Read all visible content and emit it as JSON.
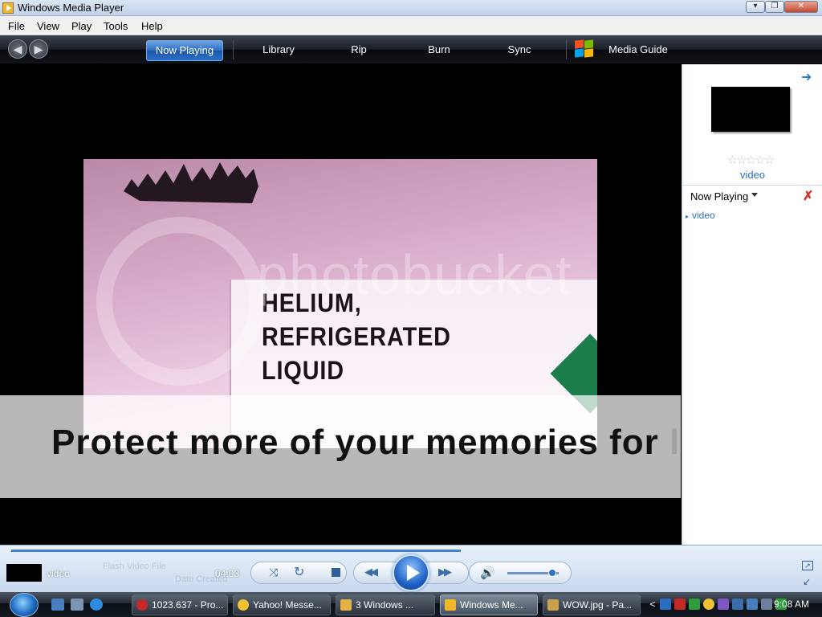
{
  "window": {
    "title": "Windows Media Player",
    "min": "▾",
    "max": "❐",
    "close": "✕"
  },
  "menu": [
    "File",
    "View",
    "Play",
    "Tools",
    "Help"
  ],
  "nav": {
    "back": "◀",
    "forward": "▶",
    "tabs": [
      "Now Playing",
      "Library",
      "Rip",
      "Burn",
      "Sync",
      "Media Guide"
    ]
  },
  "video": {
    "sign_text": "HELIUM,\nREFRIGERATED\nLIQUID",
    "watermark": "photobucket",
    "banner": {
      "main": "Protect more of your memories for",
      "faint": " less!"
    }
  },
  "pane": {
    "arrow": "➜",
    "rating_stars": "☆☆☆☆☆",
    "title": "video",
    "nowplaying_label": "Now Playing",
    "clear_icon": "✗",
    "list": [
      {
        "marker": "▸",
        "title": "video"
      }
    ]
  },
  "transport": {
    "media_title": "video",
    "elapsed": "04:03",
    "ghost_lines": [
      "Flash Video File",
      "Date Created"
    ],
    "shuffle": "⤨",
    "repeat": "↻",
    "prev": "◀◀",
    "next": "▶▶",
    "volume_icon": "🔊",
    "volume_level_pct": 88,
    "fullscreen": "↗",
    "compact": "↙"
  },
  "taskbar": {
    "tasks": [
      {
        "label": "1023.637 - Pro...",
        "color": "#c62828"
      },
      {
        "label": "Yahoo! Messe...",
        "color": "#f2c230"
      },
      {
        "label": "3 Windows ...",
        "color": "#e2b246"
      },
      {
        "label": "Windows Me...",
        "color": "#f3b72b"
      },
      {
        "label": "WOW.jpg - Pa...",
        "color": "#c9a04c"
      }
    ],
    "tray_arrow": "<",
    "clock": "9:08 AM"
  }
}
